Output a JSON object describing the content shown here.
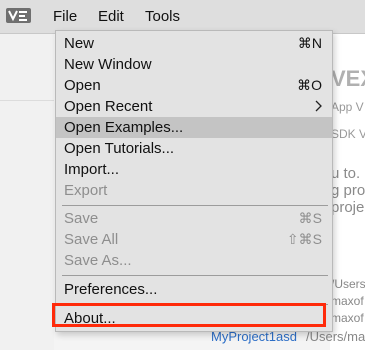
{
  "menubar": {
    "logo_icon": "vex-logo-icon",
    "items": [
      {
        "label": "File"
      },
      {
        "label": "Edit"
      },
      {
        "label": "Tools"
      }
    ]
  },
  "file_menu": {
    "items": [
      {
        "label": "New",
        "shortcut": "⌘N",
        "enabled": true
      },
      {
        "label": "New Window",
        "shortcut": "",
        "enabled": true
      },
      {
        "label": "Open",
        "shortcut": "⌘O",
        "enabled": true
      },
      {
        "label": "Open Recent",
        "shortcut": "",
        "submenu": true,
        "enabled": true
      },
      {
        "label": "Open Examples...",
        "shortcut": "",
        "enabled": true,
        "highlighted": true
      },
      {
        "label": "Open Tutorials...",
        "shortcut": "",
        "enabled": true
      },
      {
        "label": "Import...",
        "shortcut": "",
        "enabled": true
      },
      {
        "label": "Export",
        "shortcut": "",
        "enabled": false
      },
      {
        "label": "Save",
        "shortcut": "⌘S",
        "enabled": false
      },
      {
        "label": "Save All",
        "shortcut": "⇧⌘S",
        "enabled": false
      },
      {
        "label": "Save As...",
        "shortcut": "",
        "enabled": false
      },
      {
        "label": "Preferences...",
        "shortcut": "",
        "enabled": true
      },
      {
        "label": "About...",
        "shortcut": "",
        "enabled": true,
        "annotated": true
      }
    ]
  },
  "background": {
    "title": "VEX",
    "line1": "App V",
    "line2": "SDK V",
    "line3": "u to.",
    "line4": "g pro",
    "line5": "proje",
    "path1": "/Users/m",
    "path2": "maxof",
    "path3": "maxof",
    "project_name": "MyProject1asd",
    "project_path": "/Users/ma"
  },
  "colors": {
    "annotation": "#ff2a0a",
    "link": "#2d6fc8",
    "highlight": "#c4c4c4"
  }
}
